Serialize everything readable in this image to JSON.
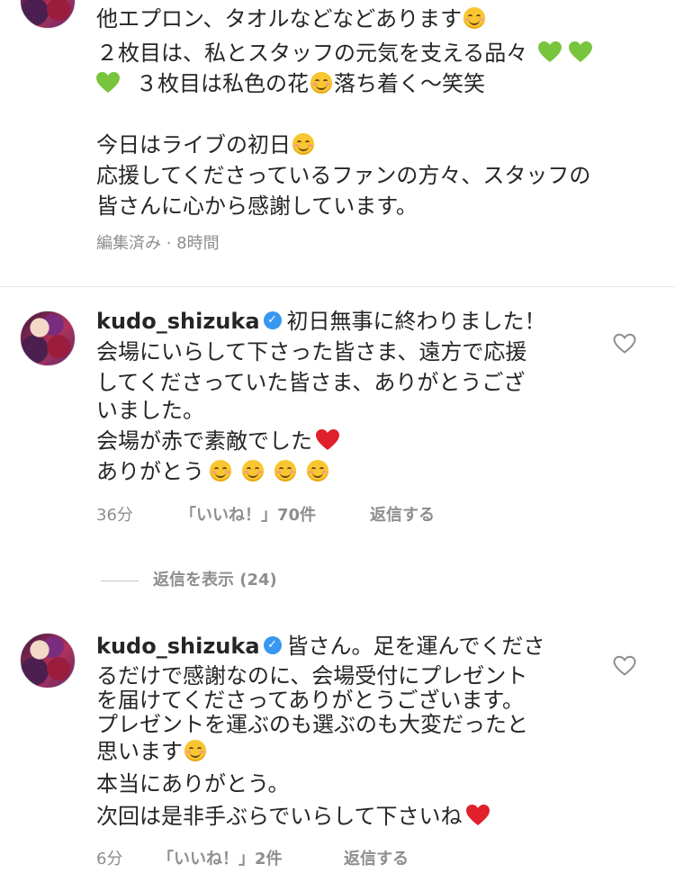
{
  "top_comment": {
    "lines": [
      "他エプロン、タオルなどなどあります",
      "２枚目は、私とスタッフの元気を支える品々",
      "３枚目は私色の花",
      "落ち着く〜笑笑",
      "今日はライブの初日",
      "応援してくださっているファンの方々、スタッフの",
      "皆さんに心から感謝しています。"
    ],
    "meta": "編集済み · 8時間"
  },
  "comments": [
    {
      "username": "kudo_shizuka",
      "first_text": "初日無事に終わりました！",
      "lines": [
        "会場にいらして下さった皆さま、遠方で応援",
        "してくださっていた皆さま、ありがとうござ",
        "いました。",
        "会場が赤で素敵でした",
        "ありがとう"
      ],
      "time": "36分",
      "likes": "「いいね！」70件",
      "reply": "返信する"
    },
    {
      "username": "kudo_shizuka",
      "first_text": "皆さん。足を運んでくださ",
      "lines": [
        "るだけで感謝なのに、会場受付にプレゼント",
        "を届けてくださってありがとうございます。",
        "プレゼントを運ぶのも選ぶのも大変だったと",
        "思います",
        "本当にありがとう。",
        "次回は是非手ぶらでいらして下さいね"
      ],
      "time": "6分",
      "likes": "「いいね！」2件",
      "reply": "返信する"
    }
  ],
  "view_replies": "返信を表示 (24)",
  "icons": {
    "verified": "verified-badge-icon",
    "like": "heart-outline-icon",
    "emoji_smile": "smiling-face-emoji",
    "emoji_green_heart": "green-heart-emoji",
    "emoji_red_heart": "red-heart-emoji"
  },
  "colors": {
    "text": "#262626",
    "meta": "#8e8e8e",
    "verified": "#3897f0",
    "green_heart": "#78c43c",
    "red_heart": "#e0202a"
  }
}
